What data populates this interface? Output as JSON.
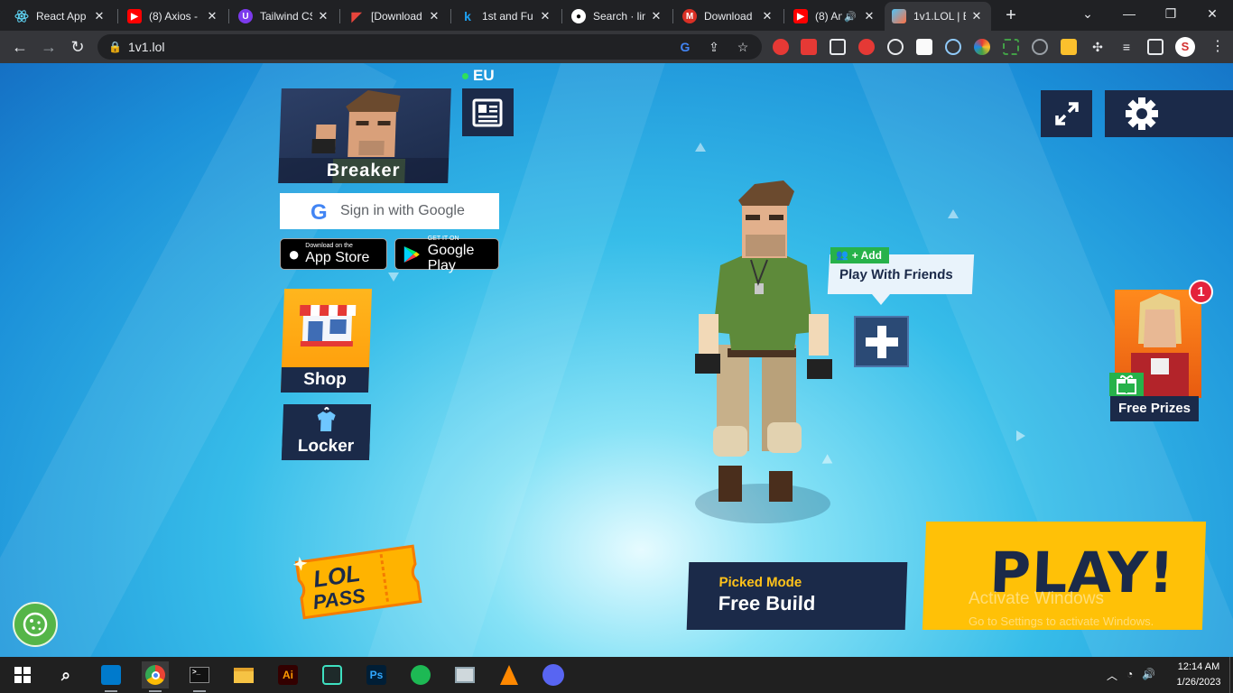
{
  "browser": {
    "tabs": [
      {
        "title": "React App",
        "icon": "react-icon",
        "color": "#61dafb"
      },
      {
        "title": "(8) Axios -",
        "icon": "youtube-icon",
        "color": "#ff0000"
      },
      {
        "title": "Tailwind CS",
        "icon": "tailwind-icon",
        "color": "#7c3aed"
      },
      {
        "title": "[Download",
        "icon": "download-site-icon",
        "color": "#e8453c"
      },
      {
        "title": "1st and Fu",
        "icon": "k-icon",
        "color": "#1da1f2"
      },
      {
        "title": "Search · lin",
        "icon": "github-icon",
        "color": "#ffffff"
      },
      {
        "title": "Download",
        "icon": "m-icon",
        "color": "#d93025"
      },
      {
        "title": "(8) And",
        "icon": "youtube-icon",
        "color": "#ff0000"
      },
      {
        "title": "1v1.LOL | E",
        "icon": "1v1lol-icon",
        "color": "#4fc3f7",
        "active": true
      }
    ],
    "url": "1v1.lol"
  },
  "game": {
    "region": "EU",
    "skin_name": "Breaker",
    "google_signin": "Sign in with Google",
    "app_store": {
      "small": "Download on the",
      "large": "App Store"
    },
    "google_play": {
      "small": "GET IT ON",
      "large": "Google Play"
    },
    "shop_label": "Shop",
    "locker_label": "Locker",
    "add_label": "+ Add",
    "play_with_friends": "Play With Friends",
    "free_prizes": "Free Prizes",
    "prizes_count": "1",
    "lol_pass": {
      "line1": "LOL",
      "line2": "PASS"
    },
    "mode_key": "Picked Mode",
    "mode_value": "Free Build",
    "play_label": "PLAY!"
  },
  "watermark": {
    "line1": "Activate Windows",
    "line2": "Go to Settings to activate Windows."
  },
  "taskbar": {
    "time": "12:14 AM",
    "date": "1/26/2023",
    "apps": [
      "vscode",
      "chrome",
      "terminal",
      "file-explorer",
      "illustrator",
      "capcut",
      "photoshop",
      "spotify",
      "photos",
      "vlc",
      "discord"
    ]
  },
  "colors": {
    "navy": "#1b2a49",
    "play_yellow": "#ffc107",
    "accent_orange": "#ff9a07",
    "green": "#27b24a",
    "badge_red": "#e4223b"
  }
}
